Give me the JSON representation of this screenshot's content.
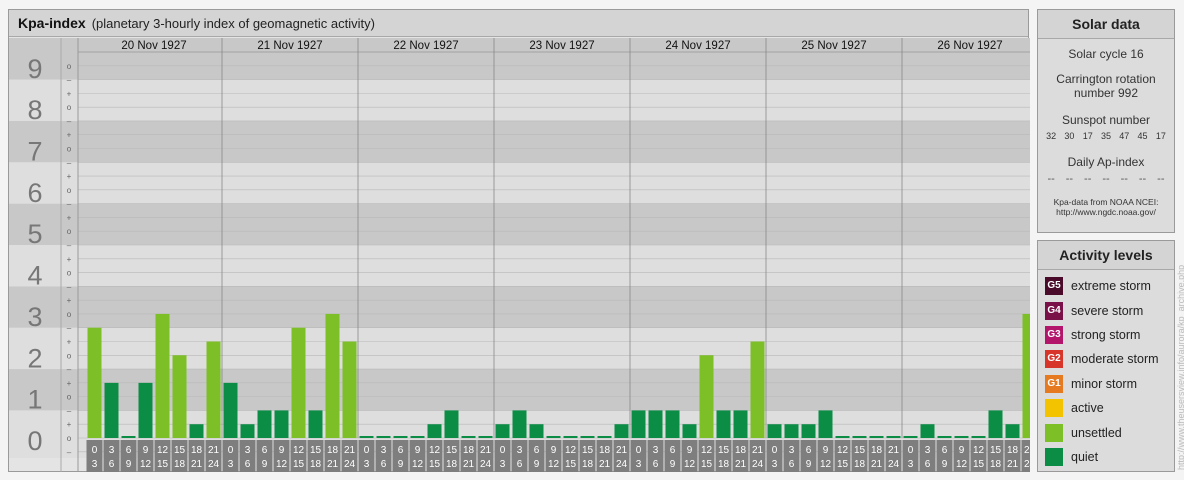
{
  "header": {
    "title": "Kpa-index",
    "subtitle": "(planetary 3-hourly index of geomagnetic activity)"
  },
  "chart_data": {
    "type": "bar",
    "title": "Kpa-index",
    "subtitle": "(planetary 3-hourly index of geomagnetic activity)",
    "ylim": [
      0,
      9
    ],
    "y_ticks": [
      "0",
      "1",
      "2",
      "3",
      "4",
      "5",
      "6",
      "7",
      "8",
      "9"
    ],
    "y_minor_ticks": [
      "o",
      "+",
      "–"
    ],
    "days": [
      "20 Nov 1927",
      "21 Nov 1927",
      "22 Nov 1927",
      "23 Nov 1927",
      "24 Nov 1927",
      "25 Nov 1927",
      "26 Nov 1927"
    ],
    "interval_start_labels": [
      "0",
      "3",
      "6",
      "9",
      "12",
      "15",
      "18",
      "21"
    ],
    "interval_end_labels": [
      "3",
      "6",
      "9",
      "12",
      "15",
      "18",
      "21",
      "24"
    ],
    "values": [
      2.667,
      1.333,
      0.0,
      1.333,
      3.0,
      2.0,
      0.333,
      2.333,
      1.333,
      0.333,
      0.667,
      0.667,
      2.667,
      0.667,
      3.0,
      2.333,
      0.0,
      0.0,
      0.0,
      0.0,
      0.333,
      0.667,
      0.0,
      0.0,
      0.333,
      0.667,
      0.333,
      0.0,
      0.0,
      0.0,
      0.0,
      0.333,
      0.667,
      0.667,
      0.667,
      0.333,
      2.0,
      0.667,
      0.667,
      2.333,
      0.333,
      0.333,
      0.333,
      0.667,
      0.0,
      0.0,
      0.0,
      0.0,
      0.0,
      0.333,
      0.0,
      0.0,
      0.0,
      0.667,
      0.333,
      3.0
    ],
    "colors": {
      "quiet": "#0b8d46",
      "unsettled": "#7dbf26",
      "band_light": "#dedede",
      "band_dark": "#c8c8c8"
    }
  },
  "solar": {
    "title": "Solar data",
    "cycle": "Solar cycle 16",
    "carrington_line1": "Carrington rotation",
    "carrington_line2": "number 992",
    "sunspot_label": "Sunspot number",
    "sunspot_values": [
      "32",
      "30",
      "17",
      "35",
      "47",
      "45",
      "17"
    ],
    "ap_label": "Daily Ap-index",
    "ap_values": [
      "--",
      "--",
      "--",
      "--",
      "--",
      "--",
      "--"
    ],
    "source_line1": "Kpa-data from NOAA NCEI:",
    "source_line2": "http://www.ngdc.noaa.gov/"
  },
  "levels": {
    "title": "Activity levels",
    "items": [
      {
        "badge": "G5",
        "label": "extreme storm",
        "color": "#4a0a2a"
      },
      {
        "badge": "G4",
        "label": "severe storm",
        "color": "#7a1048"
      },
      {
        "badge": "G3",
        "label": "strong storm",
        "color": "#b3156a"
      },
      {
        "badge": "G2",
        "label": "moderate storm",
        "color": "#d8352a"
      },
      {
        "badge": "G1",
        "label": "minor storm",
        "color": "#e57a20"
      },
      {
        "badge": "",
        "label": "active",
        "color": "#f4c300"
      },
      {
        "badge": "",
        "label": "unsettled",
        "color": "#7dbf26"
      },
      {
        "badge": "",
        "label": "quiet",
        "color": "#0b8d46"
      }
    ]
  },
  "credit": "http://www.theusersview.info/aurora/kp_archive.php"
}
